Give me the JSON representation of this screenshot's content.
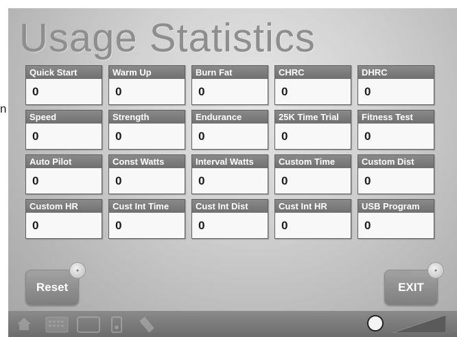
{
  "page": {
    "title": "Usage Statistics",
    "stray_char": "n"
  },
  "stats": [
    {
      "label": "Quick Start",
      "value": "0"
    },
    {
      "label": "Warm Up",
      "value": "0"
    },
    {
      "label": "Burn Fat",
      "value": "0"
    },
    {
      "label": "CHRC",
      "value": "0"
    },
    {
      "label": "DHRC",
      "value": "0"
    },
    {
      "label": "Speed",
      "value": "0"
    },
    {
      "label": "Strength",
      "value": "0"
    },
    {
      "label": "Endurance",
      "value": "0"
    },
    {
      "label": "25K Time Trial",
      "value": "0"
    },
    {
      "label": "Fitness Test",
      "value": "0"
    },
    {
      "label": "Auto Pilot",
      "value": "0"
    },
    {
      "label": "Const Watts",
      "value": "0"
    },
    {
      "label": "Interval Watts",
      "value": "0"
    },
    {
      "label": "Custom Time",
      "value": "0"
    },
    {
      "label": "Custom Dist",
      "value": "0"
    },
    {
      "label": "Custom HR",
      "value": "0"
    },
    {
      "label": "Cust Int Time",
      "value": "0"
    },
    {
      "label": "Cust Int Dist",
      "value": "0"
    },
    {
      "label": "Cust Int HR",
      "value": "0"
    },
    {
      "label": "USB Program",
      "value": "0"
    }
  ],
  "buttons": {
    "reset_label": "Reset",
    "exit_label": "EXIT"
  },
  "taskbar": {
    "icons": [
      "home-icon",
      "calendar-icon",
      "screen-icon",
      "player-icon",
      "usb-icon",
      "volume-icon",
      "volume-level-icon"
    ]
  },
  "colors": {
    "cell_header": "#7a7a7a",
    "cell_body": "#f8f8f8",
    "title": "#8e8e8e",
    "taskbar": "#777777"
  }
}
